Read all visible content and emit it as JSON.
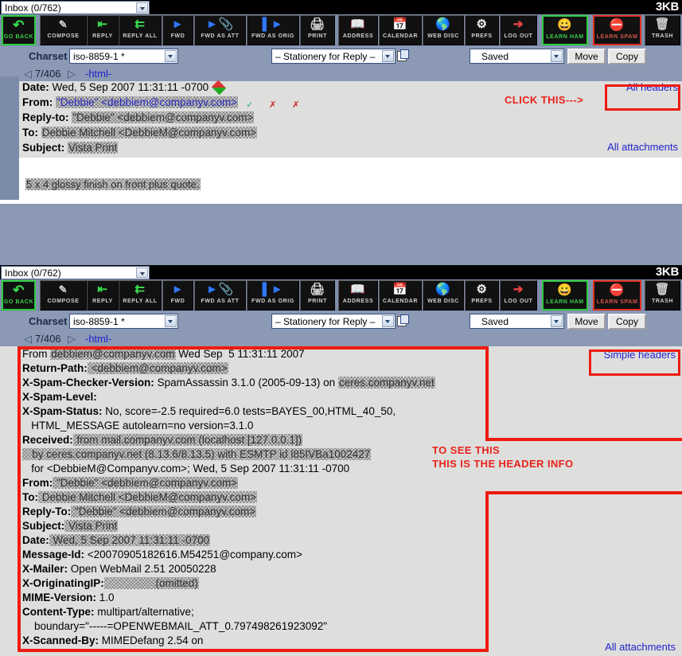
{
  "app": {
    "folder_label": "Inbox (0/762)",
    "size_label": "3KB"
  },
  "toolbar": {
    "buttons": [
      {
        "label": "GO BACK",
        "icon": "back-arrow-icon",
        "style": "green"
      },
      {
        "label": "COMPOSE",
        "icon": "pencil-icon",
        "style": "plain"
      },
      {
        "label": "REPLY",
        "icon": "reply-arrow-icon",
        "style": "plain"
      },
      {
        "label": "REPLY ALL",
        "icon": "reply-all-icon",
        "style": "plain"
      },
      {
        "label": "FWD",
        "icon": "forward-icon",
        "style": "plain"
      },
      {
        "label": "FWD AS ATT",
        "icon": "forward-attach-icon",
        "style": "plain"
      },
      {
        "label": "FWD AS ORIG",
        "icon": "forward-orig-icon",
        "style": "plain"
      },
      {
        "label": "PRINT",
        "icon": "printer-icon",
        "style": "plain"
      },
      {
        "label": "ADDRESS",
        "icon": "address-book-icon",
        "style": "plain"
      },
      {
        "label": "CALENDAR",
        "icon": "calendar-icon",
        "style": "plain"
      },
      {
        "label": "WEB DISC",
        "icon": "globe-icon",
        "style": "plain"
      },
      {
        "label": "PREFS",
        "icon": "gear-wrench-icon",
        "style": "plain"
      },
      {
        "label": "LOG OUT",
        "icon": "logout-door-icon",
        "style": "plain"
      },
      {
        "label": "LEARN HAM",
        "icon": "ham-smiley-icon",
        "style": "green"
      },
      {
        "label": "LEARN SPAM",
        "icon": "spam-no-entry-icon",
        "style": "red"
      },
      {
        "label": "TRASH",
        "icon": "trash-can-icon",
        "style": "plain"
      }
    ]
  },
  "charset_bar": {
    "charset_label": "Charset",
    "charset_value": "iso-8859-1 *",
    "stationery_value": "– Stationery for Reply –",
    "folder_target_value": "Saved",
    "move_label": "Move",
    "copy_label": "Copy"
  },
  "nav": {
    "prev_arrow": "◁",
    "counter": "7/406",
    "next_arrow": "▷",
    "html_link": "-html-"
  },
  "panel_simple": {
    "headers": [
      {
        "name": "Date:",
        "value": "Wed, 5 Sep 2007 11:31:11 -0700",
        "redacted": false
      },
      {
        "name": "From:",
        "value": "\"Debbie\" <debbiem@companyv.com>",
        "redacted": true
      },
      {
        "name": "Reply-to:",
        "value": "\"Debbie\" <debbiem@companyv.com>",
        "redacted": true
      },
      {
        "name": "To:",
        "value": "Debbie Mitchell <DebbieM@companyv.com>",
        "redacted": true
      },
      {
        "name": "Subject:",
        "value": "Vista Print",
        "redacted": true
      }
    ],
    "all_headers_link": "All headers",
    "all_attachments_link": "All attachments",
    "body_text": "5 x 4 glossy finish on front plus quote.",
    "annotation": "CLICK THIS--->"
  },
  "panel_full": {
    "simple_headers_link": "Simple headers",
    "all_attachments_link": "All attachments",
    "annotation_line1": "TO SEE THIS",
    "annotation_line2": "THIS IS THE HEADER INFO",
    "lines": [
      {
        "name": "From ",
        "value": "debbiem@companyv.com",
        "tail": " Wed Sep  5 11:31:11 2007",
        "bold": false,
        "redacted": true
      },
      {
        "name": "Return-Path:",
        "value": " <debbiem@companyv.com>",
        "bold": true,
        "redacted": true
      },
      {
        "name": "X-Spam-Checker-Version:",
        "value": " SpamAssassin 3.1.0 (2005-09-13) on ",
        "tail_redacted": "ceres.companyv.net",
        "bold": true,
        "redacted": false
      },
      {
        "name": "X-Spam-Level:",
        "value": "",
        "bold": true,
        "redacted": false
      },
      {
        "name": "X-Spam-Status:",
        "value": " No, score=-2.5 required=6.0 tests=BAYES_00,HTML_40_50,",
        "bold": true,
        "redacted": false
      },
      {
        "name": "",
        "value": "   HTML_MESSAGE autolearn=no version=3.1.0",
        "bold": false,
        "redacted": false
      },
      {
        "name": "Received:",
        "value": " from mail.companyv.com (localhost [127.0.0.1])",
        "bold": true,
        "redacted": true
      },
      {
        "name": "",
        "value": "   by ceres.companyv.net (8.13.6/8.13.5) with ESMTP id l85IVBa1002427",
        "bold": false,
        "redacted": true
      },
      {
        "name": "",
        "value": "   for <DebbieM@Companyv.com>; Wed, 5 Sep 2007 11:31:11 -0700",
        "bold": false,
        "redacted": "partial"
      },
      {
        "name": "From:",
        "value": " \"Debbie\" <debbiem@companyv.com>",
        "bold": true,
        "redacted": true
      },
      {
        "name": "To:",
        "value": " Debbie Mitchell <DebbieM@companyv.com>",
        "bold": true,
        "redacted": true
      },
      {
        "name": "Reply-To:",
        "value": " \"Debbie\" <debbiem@companyv.com>",
        "bold": true,
        "redacted": true
      },
      {
        "name": "Subject:",
        "value": " Vista Print",
        "bold": true,
        "redacted": true
      },
      {
        "name": "Date:",
        "value": " Wed, 5 Sep 2007 11:31:11 -0700",
        "bold": true,
        "redacted": true
      },
      {
        "name": "Message-Id:",
        "value": " <20070905182616.M54251@company.com>",
        "bold": true,
        "redacted": "partial"
      },
      {
        "name": "X-Mailer:",
        "value": " Open WebMail 2.51 20050228",
        "bold": true,
        "redacted": false
      },
      {
        "name": "X-OriginatingIP:",
        "value": "                 (omitted)",
        "bold": true,
        "redacted": true
      },
      {
        "name": "MIME-Version:",
        "value": " 1.0",
        "bold": true,
        "redacted": false
      },
      {
        "name": "Content-Type:",
        "value": " multipart/alternative;",
        "bold": true,
        "redacted": false
      },
      {
        "name": "",
        "value": "    boundary=\"-----=OPENWEBMAIL_ATT_0.797498261923092\"",
        "bold": false,
        "redacted": false
      },
      {
        "name": "X-Scanned-By:",
        "value": " MIMEDefang 2.54 on",
        "bold": true,
        "redacted": false
      }
    ]
  },
  "colors": {
    "annotation_red": "#ee1b10",
    "link_blue": "#2222cc",
    "desktop_blue": "#8b99b5",
    "panel_gray": "#dededd",
    "toolbar_black": "#111111",
    "ham_green": "#2ecc40",
    "spam_red": "#e03020"
  }
}
